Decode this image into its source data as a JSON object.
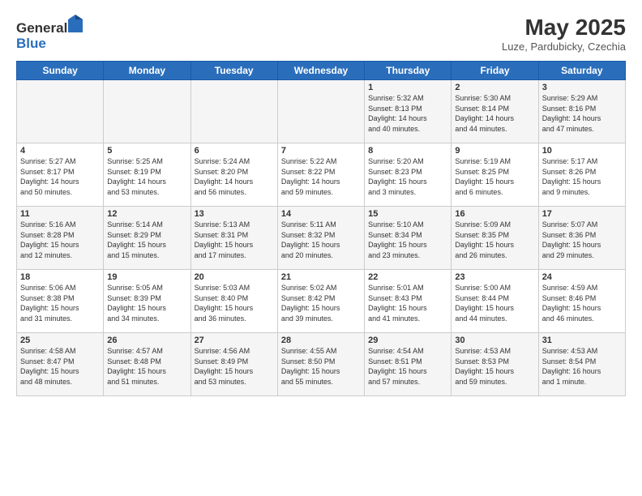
{
  "header": {
    "logo_line1": "General",
    "logo_line2": "Blue",
    "month_year": "May 2025",
    "location": "Luze, Pardubicky, Czechia"
  },
  "weekdays": [
    "Sunday",
    "Monday",
    "Tuesday",
    "Wednesday",
    "Thursday",
    "Friday",
    "Saturday"
  ],
  "weeks": [
    [
      {
        "day": "",
        "info": ""
      },
      {
        "day": "",
        "info": ""
      },
      {
        "day": "",
        "info": ""
      },
      {
        "day": "",
        "info": ""
      },
      {
        "day": "1",
        "info": "Sunrise: 5:32 AM\nSunset: 8:13 PM\nDaylight: 14 hours\nand 40 minutes."
      },
      {
        "day": "2",
        "info": "Sunrise: 5:30 AM\nSunset: 8:14 PM\nDaylight: 14 hours\nand 44 minutes."
      },
      {
        "day": "3",
        "info": "Sunrise: 5:29 AM\nSunset: 8:16 PM\nDaylight: 14 hours\nand 47 minutes."
      }
    ],
    [
      {
        "day": "4",
        "info": "Sunrise: 5:27 AM\nSunset: 8:17 PM\nDaylight: 14 hours\nand 50 minutes."
      },
      {
        "day": "5",
        "info": "Sunrise: 5:25 AM\nSunset: 8:19 PM\nDaylight: 14 hours\nand 53 minutes."
      },
      {
        "day": "6",
        "info": "Sunrise: 5:24 AM\nSunset: 8:20 PM\nDaylight: 14 hours\nand 56 minutes."
      },
      {
        "day": "7",
        "info": "Sunrise: 5:22 AM\nSunset: 8:22 PM\nDaylight: 14 hours\nand 59 minutes."
      },
      {
        "day": "8",
        "info": "Sunrise: 5:20 AM\nSunset: 8:23 PM\nDaylight: 15 hours\nand 3 minutes."
      },
      {
        "day": "9",
        "info": "Sunrise: 5:19 AM\nSunset: 8:25 PM\nDaylight: 15 hours\nand 6 minutes."
      },
      {
        "day": "10",
        "info": "Sunrise: 5:17 AM\nSunset: 8:26 PM\nDaylight: 15 hours\nand 9 minutes."
      }
    ],
    [
      {
        "day": "11",
        "info": "Sunrise: 5:16 AM\nSunset: 8:28 PM\nDaylight: 15 hours\nand 12 minutes."
      },
      {
        "day": "12",
        "info": "Sunrise: 5:14 AM\nSunset: 8:29 PM\nDaylight: 15 hours\nand 15 minutes."
      },
      {
        "day": "13",
        "info": "Sunrise: 5:13 AM\nSunset: 8:31 PM\nDaylight: 15 hours\nand 17 minutes."
      },
      {
        "day": "14",
        "info": "Sunrise: 5:11 AM\nSunset: 8:32 PM\nDaylight: 15 hours\nand 20 minutes."
      },
      {
        "day": "15",
        "info": "Sunrise: 5:10 AM\nSunset: 8:34 PM\nDaylight: 15 hours\nand 23 minutes."
      },
      {
        "day": "16",
        "info": "Sunrise: 5:09 AM\nSunset: 8:35 PM\nDaylight: 15 hours\nand 26 minutes."
      },
      {
        "day": "17",
        "info": "Sunrise: 5:07 AM\nSunset: 8:36 PM\nDaylight: 15 hours\nand 29 minutes."
      }
    ],
    [
      {
        "day": "18",
        "info": "Sunrise: 5:06 AM\nSunset: 8:38 PM\nDaylight: 15 hours\nand 31 minutes."
      },
      {
        "day": "19",
        "info": "Sunrise: 5:05 AM\nSunset: 8:39 PM\nDaylight: 15 hours\nand 34 minutes."
      },
      {
        "day": "20",
        "info": "Sunrise: 5:03 AM\nSunset: 8:40 PM\nDaylight: 15 hours\nand 36 minutes."
      },
      {
        "day": "21",
        "info": "Sunrise: 5:02 AM\nSunset: 8:42 PM\nDaylight: 15 hours\nand 39 minutes."
      },
      {
        "day": "22",
        "info": "Sunrise: 5:01 AM\nSunset: 8:43 PM\nDaylight: 15 hours\nand 41 minutes."
      },
      {
        "day": "23",
        "info": "Sunrise: 5:00 AM\nSunset: 8:44 PM\nDaylight: 15 hours\nand 44 minutes."
      },
      {
        "day": "24",
        "info": "Sunrise: 4:59 AM\nSunset: 8:46 PM\nDaylight: 15 hours\nand 46 minutes."
      }
    ],
    [
      {
        "day": "25",
        "info": "Sunrise: 4:58 AM\nSunset: 8:47 PM\nDaylight: 15 hours\nand 48 minutes."
      },
      {
        "day": "26",
        "info": "Sunrise: 4:57 AM\nSunset: 8:48 PM\nDaylight: 15 hours\nand 51 minutes."
      },
      {
        "day": "27",
        "info": "Sunrise: 4:56 AM\nSunset: 8:49 PM\nDaylight: 15 hours\nand 53 minutes."
      },
      {
        "day": "28",
        "info": "Sunrise: 4:55 AM\nSunset: 8:50 PM\nDaylight: 15 hours\nand 55 minutes."
      },
      {
        "day": "29",
        "info": "Sunrise: 4:54 AM\nSunset: 8:51 PM\nDaylight: 15 hours\nand 57 minutes."
      },
      {
        "day": "30",
        "info": "Sunrise: 4:53 AM\nSunset: 8:53 PM\nDaylight: 15 hours\nand 59 minutes."
      },
      {
        "day": "31",
        "info": "Sunrise: 4:53 AM\nSunset: 8:54 PM\nDaylight: 16 hours\nand 1 minute."
      }
    ]
  ]
}
